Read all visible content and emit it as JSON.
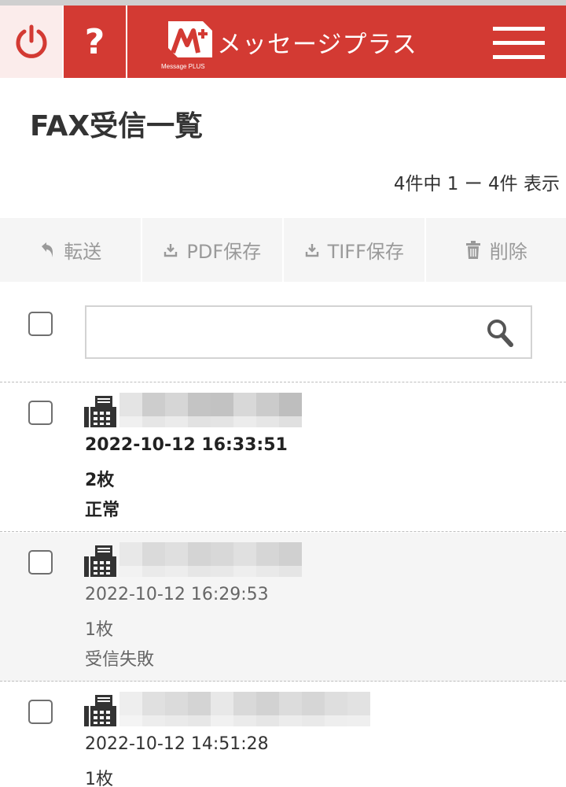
{
  "header": {
    "app_title": "メッセージプラス",
    "logo_text": "Message PLUS",
    "help_label": "?",
    "accent_color": "#d33a33",
    "icons": {
      "power": "power-icon",
      "menu": "hamburger-menu-icon"
    }
  },
  "page": {
    "title": "FAX受信一覧",
    "count_text": "4件中 1 ー 4件 表示"
  },
  "toolbar": {
    "forward_label": "転送",
    "pdf_label": "PDF保存",
    "tiff_label": "TIFF保存",
    "delete_label": "削除"
  },
  "search": {
    "placeholder": ""
  },
  "faxes": [
    {
      "datetime": "2022-10-12 16:33:51",
      "pages": "2枚",
      "status": "正常",
      "unread": true
    },
    {
      "datetime": "2022-10-12 16:29:53",
      "pages": "1枚",
      "status": "受信失敗",
      "unread": false
    },
    {
      "datetime": "2022-10-12 14:51:28",
      "pages": "1枚",
      "status": "",
      "unread": false
    }
  ]
}
